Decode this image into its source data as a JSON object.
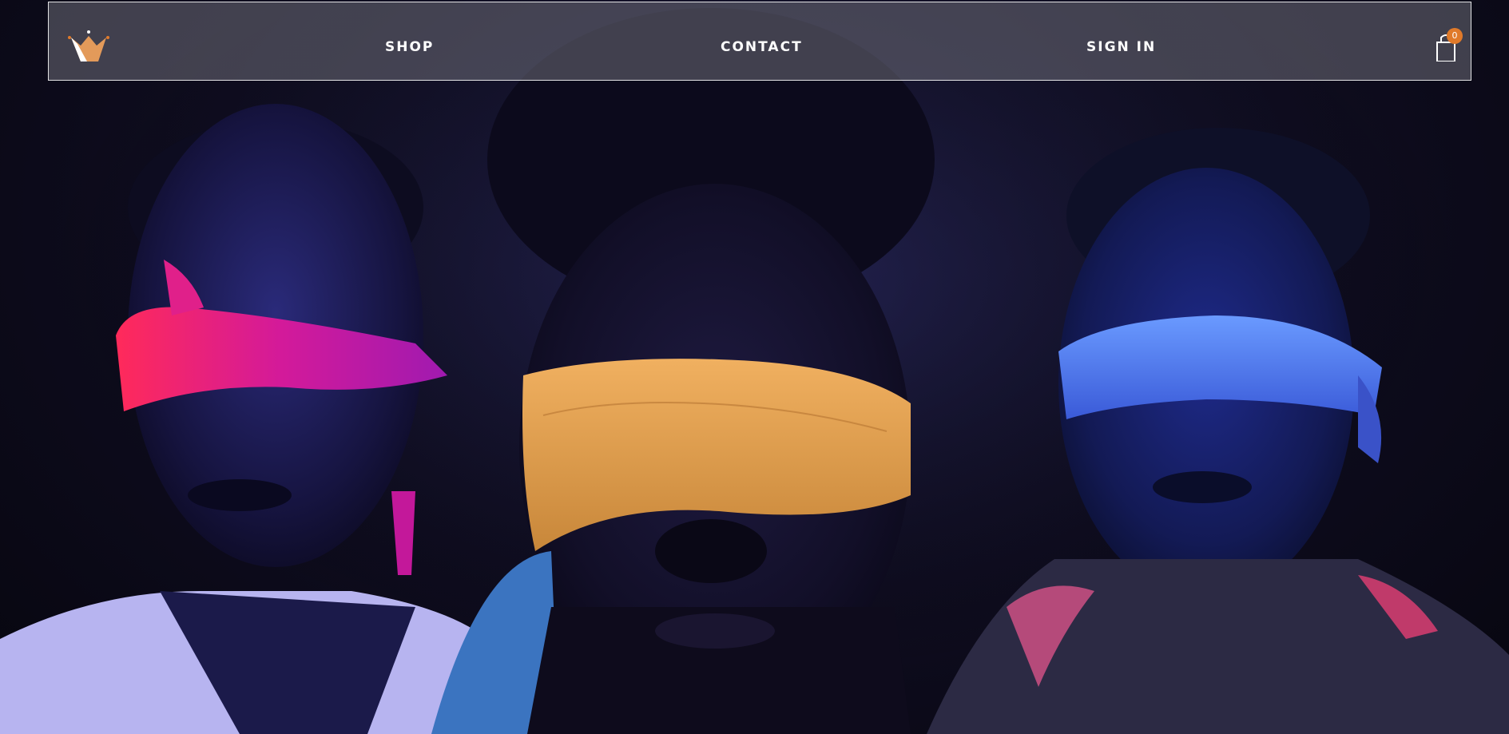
{
  "nav": {
    "links": {
      "shop": "SHOP",
      "contact": "CONTACT",
      "sign_in": "SIGN IN"
    },
    "cart": {
      "count": "0",
      "icon": "shopping-bag-icon"
    },
    "logo_icon": "crown-icon"
  },
  "hero": {
    "image_description_icon": "hero-photo"
  },
  "colors": {
    "accent": "#e07a2a",
    "nav_border": "#ffffff",
    "blindfold_left": "#d41a8a",
    "blindfold_center": "#e2a24a",
    "blindfold_right": "#4a7cff"
  }
}
